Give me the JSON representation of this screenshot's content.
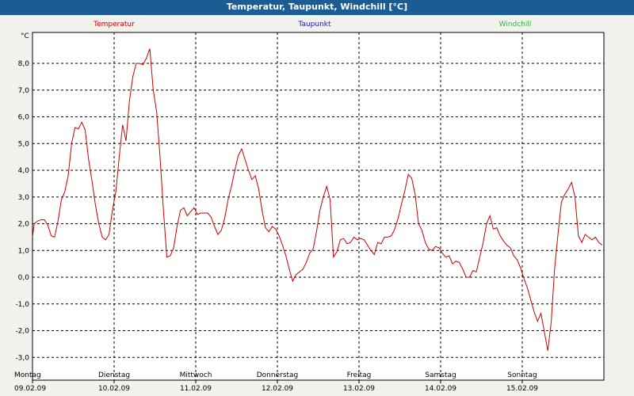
{
  "window": {
    "title": "Temperatur, Taupunkt, Windchill [°C]"
  },
  "chart_data": {
    "type": "line",
    "ylabel": "°C",
    "ylim": [
      -3.3,
      9.2
    ],
    "yticks": [
      8.0,
      7.0,
      6.0,
      5.0,
      4.0,
      3.0,
      2.0,
      1.0,
      0.0,
      -1.0,
      -2.0,
      -3.0
    ],
    "ytick_labels": [
      "8,0",
      "7,0",
      "6,0",
      "5,0",
      "4,0",
      "3,0",
      "2,0",
      "1,0",
      "0,0",
      "-1,0",
      "-2,0",
      "-3,0"
    ],
    "xlim_hours": [
      0,
      168
    ],
    "grid": true,
    "legend_position": "top",
    "days": [
      {
        "name": "Montag",
        "date": "09.02.09"
      },
      {
        "name": "Dienstag",
        "date": "10.02.09"
      },
      {
        "name": "Mittwoch",
        "date": "11.02.09"
      },
      {
        "name": "Donnerstag",
        "date": "12.02.09"
      },
      {
        "name": "Freitag",
        "date": "13.02.09"
      },
      {
        "name": "Samstag",
        "date": "14.02.09"
      },
      {
        "name": "Sonntag",
        "date": "15.02.09"
      }
    ],
    "series": [
      {
        "name": "Temperatur",
        "color": "#cc0000",
        "points": [
          [
            0,
            1.5
          ],
          [
            0.5,
            2.0
          ],
          [
            1.5,
            2.1
          ],
          [
            2.5,
            2.15
          ],
          [
            3.5,
            2.15
          ],
          [
            4.5,
            1.95
          ],
          [
            5.5,
            1.55
          ],
          [
            6.5,
            1.5
          ],
          [
            7.5,
            2.1
          ],
          [
            8.5,
            2.9
          ],
          [
            9.5,
            3.2
          ],
          [
            10.5,
            3.8
          ],
          [
            11.5,
            5.0
          ],
          [
            12.5,
            5.6
          ],
          [
            13.5,
            5.55
          ],
          [
            14.5,
            5.8
          ],
          [
            15.5,
            5.5
          ],
          [
            16.5,
            4.4
          ],
          [
            17.5,
            3.6
          ],
          [
            18.5,
            2.7
          ],
          [
            19.5,
            2.0
          ],
          [
            20.5,
            1.5
          ],
          [
            21.5,
            1.4
          ],
          [
            22.5,
            1.6
          ],
          [
            23.5,
            2.5
          ],
          [
            24.5,
            3.2
          ],
          [
            25.5,
            4.5
          ],
          [
            26.5,
            5.7
          ],
          [
            27.5,
            5.1
          ],
          [
            28.5,
            6.6
          ],
          [
            29.5,
            7.5
          ],
          [
            30.5,
            8.0
          ],
          [
            31.5,
            8.0
          ],
          [
            32.5,
            7.95
          ],
          [
            33.5,
            8.2
          ],
          [
            34.5,
            8.55
          ],
          [
            35.5,
            7.0
          ],
          [
            36.5,
            6.2
          ],
          [
            37.5,
            4.5
          ],
          [
            38.5,
            2.5
          ],
          [
            39.5,
            0.75
          ],
          [
            40.5,
            0.8
          ],
          [
            41.5,
            1.1
          ],
          [
            42.5,
            1.9
          ],
          [
            43.5,
            2.5
          ],
          [
            44.5,
            2.6
          ],
          [
            45.5,
            2.3
          ],
          [
            46.5,
            2.45
          ],
          [
            47.5,
            2.6
          ],
          [
            48.5,
            2.35
          ],
          [
            49.5,
            2.4
          ],
          [
            50.5,
            2.4
          ],
          [
            51.5,
            2.4
          ],
          [
            52.5,
            2.25
          ],
          [
            53.5,
            1.9
          ],
          [
            54.5,
            1.6
          ],
          [
            55.5,
            1.75
          ],
          [
            56.5,
            2.2
          ],
          [
            57.5,
            2.9
          ],
          [
            58.5,
            3.4
          ],
          [
            59.5,
            4.0
          ],
          [
            60.5,
            4.55
          ],
          [
            61.5,
            4.8
          ],
          [
            62.5,
            4.4
          ],
          [
            63.5,
            4.0
          ],
          [
            64.5,
            3.65
          ],
          [
            65.5,
            3.8
          ],
          [
            66.5,
            3.3
          ],
          [
            67.5,
            2.5
          ],
          [
            68.5,
            1.85
          ],
          [
            69.5,
            1.7
          ],
          [
            70.5,
            1.9
          ],
          [
            71.5,
            1.8
          ],
          [
            72.5,
            1.55
          ],
          [
            73.5,
            1.2
          ],
          [
            74.5,
            0.8
          ],
          [
            75.5,
            0.3
          ],
          [
            76.5,
            -0.15
          ],
          [
            77.5,
            0.1
          ],
          [
            78.5,
            0.2
          ],
          [
            79.5,
            0.3
          ],
          [
            80.5,
            0.55
          ],
          [
            81.5,
            0.9
          ],
          [
            82.5,
            1.05
          ],
          [
            83.5,
            1.7
          ],
          [
            84.5,
            2.5
          ],
          [
            85.5,
            3.0
          ],
          [
            86.5,
            3.4
          ],
          [
            87.5,
            2.9
          ],
          [
            88.5,
            0.75
          ],
          [
            89.5,
            0.95
          ],
          [
            90.5,
            1.4
          ],
          [
            91.5,
            1.45
          ],
          [
            92.5,
            1.25
          ],
          [
            93.5,
            1.3
          ],
          [
            94.5,
            1.5
          ],
          [
            95.5,
            1.4
          ],
          [
            96.5,
            1.45
          ],
          [
            97.5,
            1.4
          ],
          [
            98.5,
            1.2
          ],
          [
            99.5,
            1.0
          ],
          [
            100.5,
            0.85
          ],
          [
            101.5,
            1.3
          ],
          [
            102.5,
            1.25
          ],
          [
            103.5,
            1.5
          ],
          [
            104.5,
            1.5
          ],
          [
            105.5,
            1.55
          ],
          [
            106.5,
            1.8
          ],
          [
            107.5,
            2.2
          ],
          [
            108.5,
            2.75
          ],
          [
            109.5,
            3.25
          ],
          [
            110.5,
            3.85
          ],
          [
            111.5,
            3.7
          ],
          [
            112.5,
            3.1
          ],
          [
            113.5,
            2.0
          ],
          [
            114.5,
            1.75
          ],
          [
            115.5,
            1.3
          ],
          [
            116.5,
            1.05
          ],
          [
            117.5,
            1.0
          ],
          [
            118.5,
            1.15
          ],
          [
            119.5,
            1.1
          ],
          [
            120.5,
            0.9
          ],
          [
            121.5,
            0.75
          ],
          [
            122.5,
            0.8
          ],
          [
            123.5,
            0.5
          ],
          [
            124.5,
            0.6
          ],
          [
            125.5,
            0.55
          ],
          [
            126.5,
            0.3
          ],
          [
            127.5,
            0.0
          ],
          [
            128.5,
            0.0
          ],
          [
            129.5,
            0.25
          ],
          [
            130.5,
            0.2
          ],
          [
            131.5,
            0.75
          ],
          [
            132.5,
            1.3
          ],
          [
            133.5,
            2.0
          ],
          [
            134.5,
            2.3
          ],
          [
            135.5,
            1.8
          ],
          [
            136.5,
            1.85
          ],
          [
            137.5,
            1.55
          ],
          [
            138.5,
            1.35
          ],
          [
            139.5,
            1.2
          ],
          [
            140.5,
            1.1
          ],
          [
            141.5,
            0.8
          ],
          [
            142.5,
            0.65
          ],
          [
            143.5,
            0.35
          ],
          [
            144.5,
            -0.05
          ],
          [
            145.5,
            -0.4
          ],
          [
            146.5,
            -0.85
          ],
          [
            147.5,
            -1.3
          ],
          [
            148.5,
            -1.65
          ],
          [
            149.5,
            -1.35
          ],
          [
            150.5,
            -2.05
          ],
          [
            151.5,
            -2.75
          ],
          [
            152.5,
            -1.7
          ],
          [
            153.5,
            0.3
          ],
          [
            154.5,
            1.6
          ],
          [
            155.5,
            2.8
          ],
          [
            156.5,
            3.1
          ],
          [
            157.5,
            3.3
          ],
          [
            158.5,
            3.55
          ],
          [
            159.5,
            3.0
          ],
          [
            160.5,
            1.55
          ],
          [
            161.5,
            1.3
          ],
          [
            162.5,
            1.6
          ],
          [
            163.5,
            1.5
          ],
          [
            164.5,
            1.4
          ],
          [
            165.5,
            1.5
          ],
          [
            166.5,
            1.3
          ],
          [
            167.5,
            1.2
          ]
        ]
      },
      {
        "name": "Taupunkt",
        "color": "#1a1ab8",
        "points": []
      },
      {
        "name": "Windchill",
        "color": "#33b833",
        "points": []
      }
    ]
  }
}
